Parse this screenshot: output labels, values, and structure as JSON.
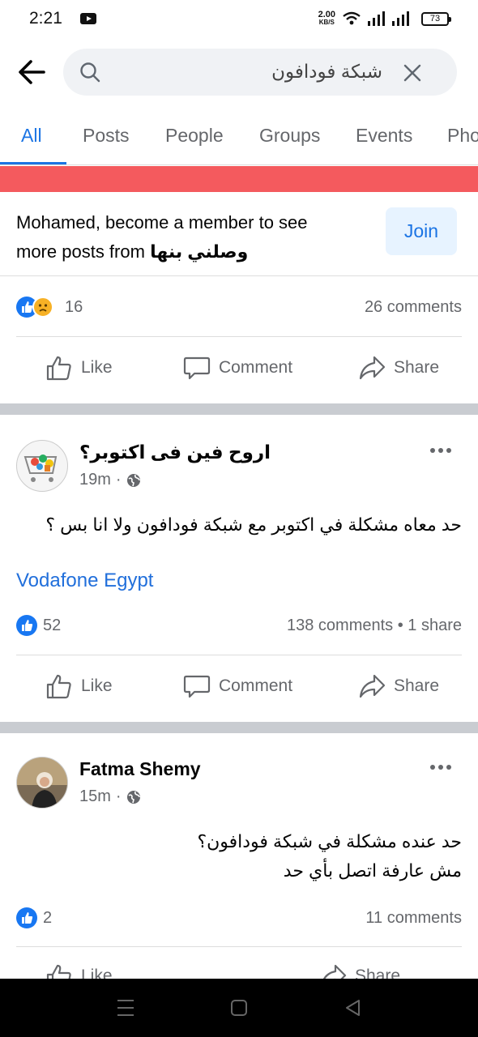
{
  "status_bar": {
    "time": "2:21",
    "net_speed_value": "2.00",
    "net_speed_unit": "KB/S",
    "battery": "73"
  },
  "search": {
    "query": "شبكة فودافون",
    "icons": [
      "back-arrow-icon",
      "search-icon",
      "close-icon"
    ]
  },
  "tabs": [
    {
      "label": "All",
      "active": true
    },
    {
      "label": "Posts"
    },
    {
      "label": "People"
    },
    {
      "label": "Groups"
    },
    {
      "label": "Events"
    },
    {
      "label": "Pho"
    }
  ],
  "colors": {
    "accent": "#1b74e4",
    "banner": "#f45a5e",
    "divider": "#c9ccd1",
    "link": "#216fdb",
    "muted": "#65676b"
  },
  "join_card": {
    "text_line1": "Mohamed, become a member to see",
    "text_line2_prefix": "more posts from",
    "group_name": "وصلني بنها",
    "button_label": "Join"
  },
  "post0": {
    "reaction_count": "16",
    "comments": "26 comments",
    "reaction_icons": [
      "like-icon",
      "sad-icon"
    ]
  },
  "actions": {
    "like": "Like",
    "comment": "Comment",
    "share": "Share"
  },
  "post1": {
    "title": "اروح فين  فى اكتوبر؟",
    "time": "19m",
    "body": "حد معاه مشكلة  في اكتوبر مع شبكة فودافون ولا انا بس ؟",
    "link": "Vodafone Egypt",
    "reaction_count": "52",
    "comments": "138 comments",
    "shares": "1 share"
  },
  "post2": {
    "author": "Fatma Shemy",
    "time": "15m",
    "body_line1": "حد عنده مشكلة في شبكة فودافون؟",
    "body_line2": "مش عارفة اتصل بأي حد",
    "reaction_count": "2",
    "comments": "11 comments"
  }
}
